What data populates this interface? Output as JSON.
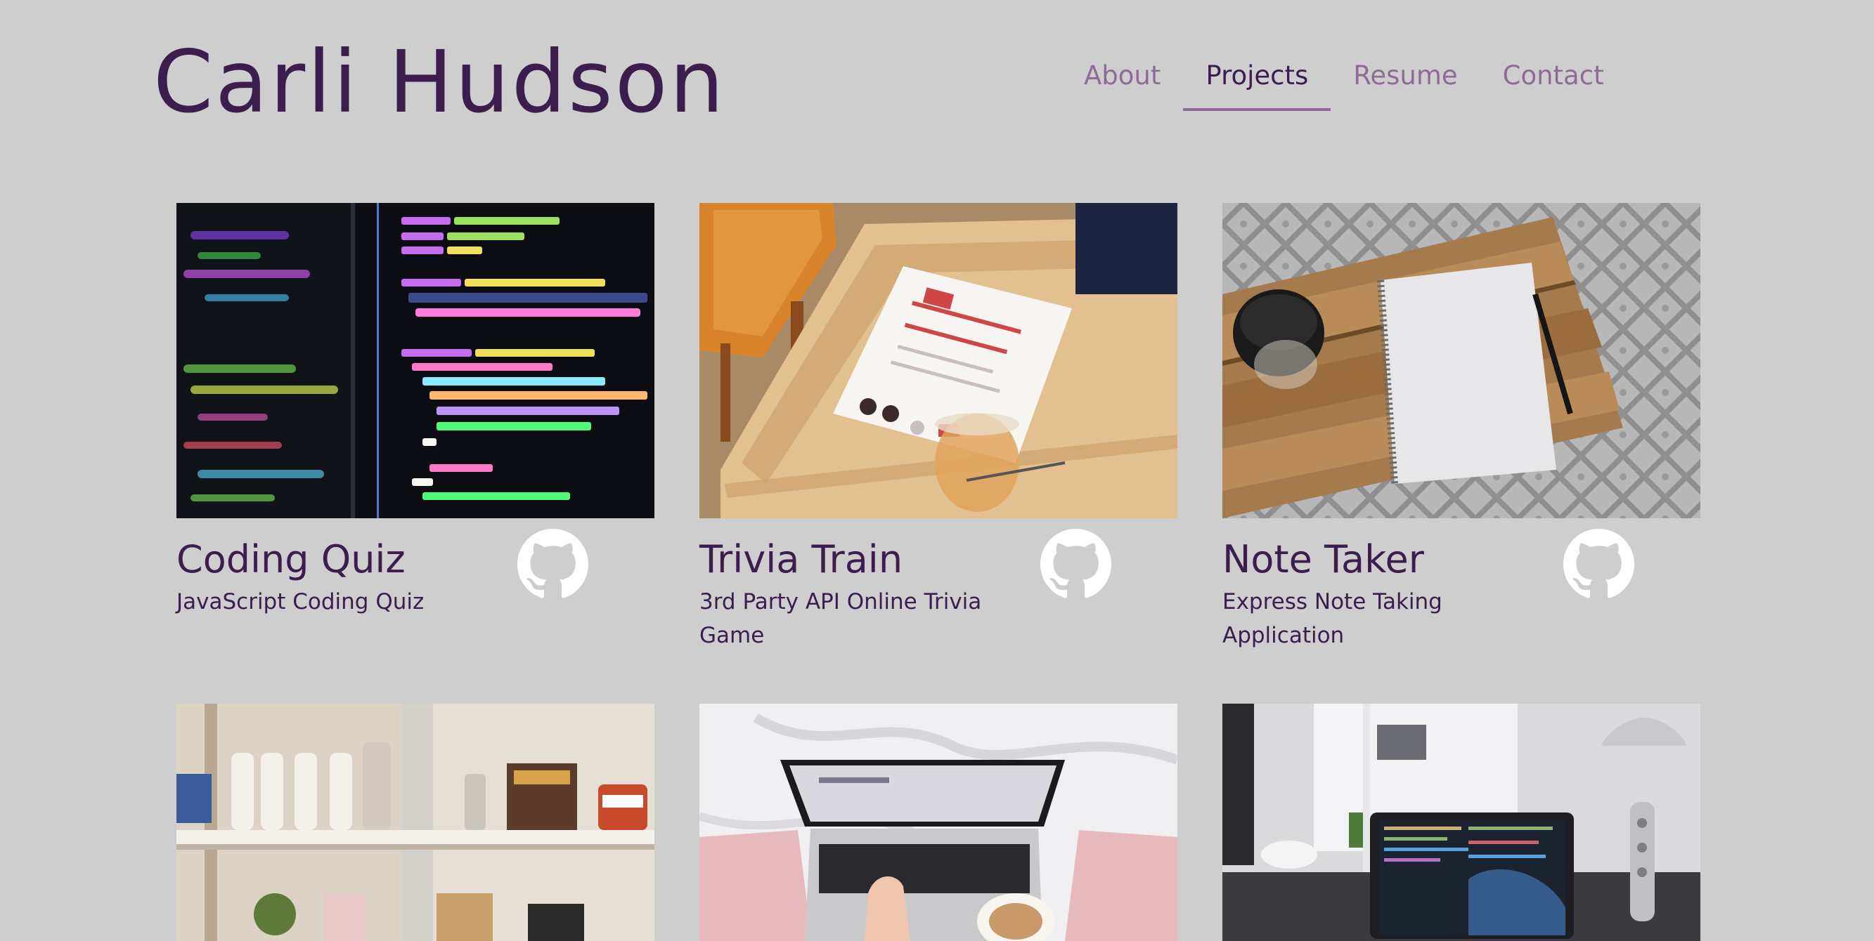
{
  "header": {
    "title": "Carli Hudson"
  },
  "nav": [
    {
      "label": "About",
      "active": false
    },
    {
      "label": "Projects",
      "active": true
    },
    {
      "label": "Resume",
      "active": false
    },
    {
      "label": "Contact",
      "active": false
    }
  ],
  "projects": [
    {
      "title": "Coding Quiz",
      "description": "JavaScript Coding Quiz",
      "image": "code-on-monitor",
      "link_icon": "github-icon"
    },
    {
      "title": "Trivia Train",
      "description": "3rd Party API Online Trivia Game",
      "image": "trivia-sheet-on-table",
      "link_icon": "github-icon"
    },
    {
      "title": "Note Taker",
      "description": "Express Note Taking Application",
      "image": "notebook-on-table",
      "link_icon": "github-icon"
    },
    {
      "image": "kitchen-shelves"
    },
    {
      "image": "laptop-on-bed"
    },
    {
      "image": "laptop-on-desk"
    }
  ],
  "colors": {
    "background": "#cecece",
    "primary": "#3b1d4e",
    "muted": "#8e6b95"
  }
}
